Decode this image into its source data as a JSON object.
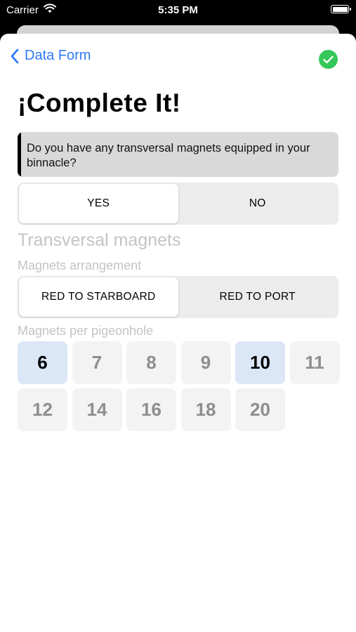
{
  "status_bar": {
    "carrier": "Carrier",
    "time": "5:35 PM"
  },
  "nav": {
    "back_label": "Data Form",
    "confirm_icon": "checkmark-circle-icon",
    "confirm_color": "#34c759",
    "accent_color": "#2f7bf5"
  },
  "page": {
    "title": "¡Complete It!",
    "question": "Do you have any transversal magnets equipped in your binnacle?"
  },
  "answer_toggle": {
    "options": [
      "YES",
      "NO"
    ],
    "selected": "YES"
  },
  "section": {
    "title": "Transversal magnets",
    "arrangement_label": "Magnets arrangement",
    "arrangement_options": [
      "RED TO STARBOARD",
      "RED TO PORT"
    ],
    "arrangement_selected": "RED TO STARBOARD",
    "pigeonhole_label": "Magnets per pigeonhole",
    "pigeonhole_options": [
      "6",
      "7",
      "8",
      "9",
      "10",
      "11",
      "12",
      "14",
      "16",
      "18",
      "20"
    ],
    "pigeonhole_selected": [
      "6",
      "10"
    ],
    "selected_color": "#dbe7f7"
  }
}
